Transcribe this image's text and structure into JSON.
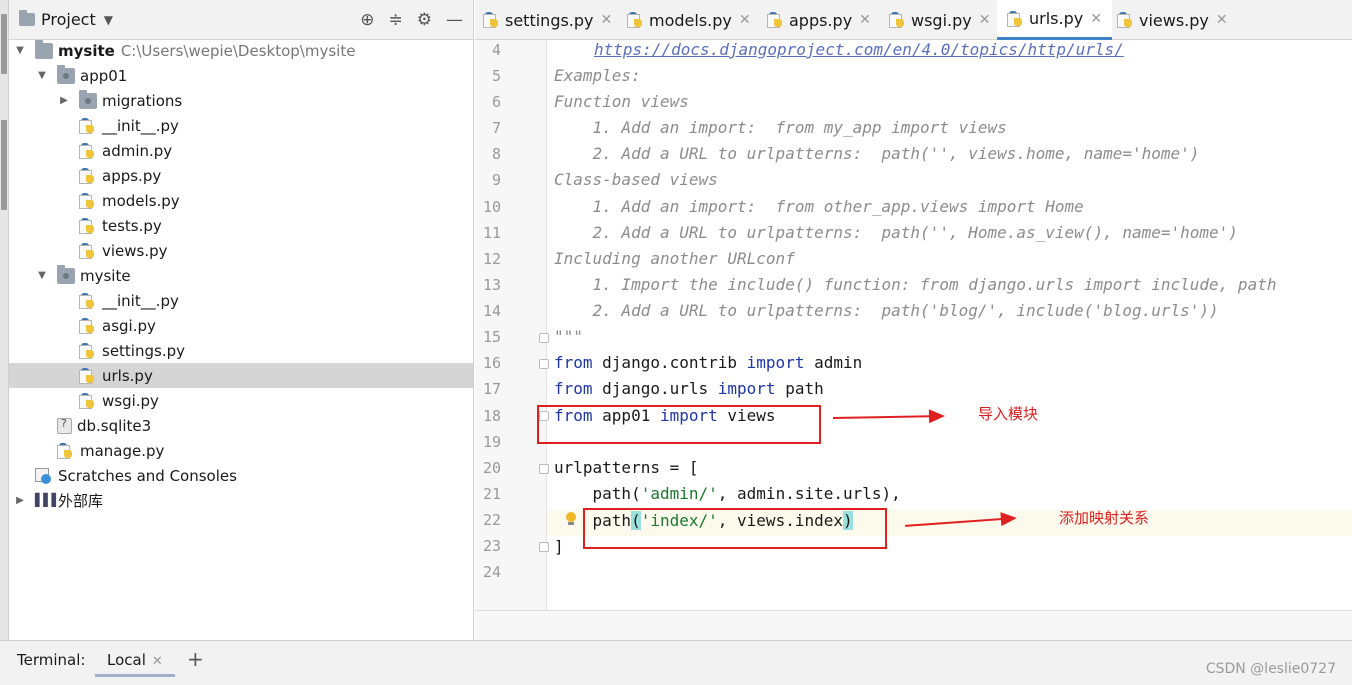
{
  "project_panel": {
    "title": "Project",
    "tree": [
      {
        "label": "mysite",
        "path": "C:\\Users\\wepie\\Desktop\\mysite",
        "kind": "folder",
        "expanded": true
      },
      {
        "label": "app01",
        "kind": "package",
        "expanded": true
      },
      {
        "label": "migrations",
        "kind": "package",
        "expanded": false
      },
      {
        "label": "__init__.py",
        "kind": "python"
      },
      {
        "label": "admin.py",
        "kind": "python"
      },
      {
        "label": "apps.py",
        "kind": "python"
      },
      {
        "label": "models.py",
        "kind": "python"
      },
      {
        "label": "tests.py",
        "kind": "python"
      },
      {
        "label": "views.py",
        "kind": "python"
      },
      {
        "label": "mysite",
        "kind": "package",
        "expanded": true
      },
      {
        "label": "__init__.py",
        "kind": "python"
      },
      {
        "label": "asgi.py",
        "kind": "python"
      },
      {
        "label": "settings.py",
        "kind": "python"
      },
      {
        "label": "urls.py",
        "kind": "python",
        "selected": true
      },
      {
        "label": "wsgi.py",
        "kind": "python"
      },
      {
        "label": "db.sqlite3",
        "kind": "database"
      },
      {
        "label": "manage.py",
        "kind": "python"
      },
      {
        "label": "Scratches and Consoles",
        "kind": "scratches"
      },
      {
        "label": "外部库",
        "kind": "library",
        "expanded": false
      }
    ]
  },
  "editor": {
    "tabs": [
      {
        "label": "settings.py",
        "active": false
      },
      {
        "label": "models.py",
        "active": false
      },
      {
        "label": "apps.py",
        "active": false
      },
      {
        "label": "wsgi.py",
        "active": false
      },
      {
        "label": "urls.py",
        "active": true
      },
      {
        "label": "views.py",
        "active": false
      }
    ],
    "line_numbers": [
      "4",
      "5",
      "6",
      "7",
      "8",
      "9",
      "10",
      "11",
      "12",
      "13",
      "14",
      "15",
      "16",
      "17",
      "18",
      "19",
      "20",
      "21",
      "22",
      "23",
      "24"
    ],
    "code": {
      "l4": "https://docs.djangoproject.com/en/4.0/topics/http/urls/",
      "l5": "Examples:",
      "l6": "Function views",
      "l7": "    1. Add an import:  from my_app import views",
      "l8": "    2. Add a URL to urlpatterns:  path('', views.home, name='home')",
      "l9": "Class-based views",
      "l10": "    1. Add an import:  from other_app.views import Home",
      "l11": "    2. Add a URL to urlpatterns:  path('', Home.as_view(), name='home')",
      "l12": "Including another URLconf",
      "l13": "    1. Import the include() function: from django.urls import include, path",
      "l14": "    2. Add a URL to urlpatterns:  path('blog/', include('blog.urls'))",
      "l15": "\"\"\"",
      "l16": {
        "from": "from",
        "module": " django.contrib ",
        "import": "import",
        "name": " admin"
      },
      "l17": {
        "from": "from",
        "module": " django.urls ",
        "import": "import",
        "name": " path"
      },
      "l18": {
        "from": "from",
        "module": " app01 ",
        "import": "import",
        "name": " views"
      },
      "l20": "urlpatterns = [",
      "l21": {
        "pre": "    path(",
        "arg": "'admin/'",
        "post": ", admin.site.urls),"
      },
      "l22": {
        "pre": "    path",
        "open": "(",
        "arg": "'index/'",
        "mid": ", views.index",
        "close": ")"
      },
      "l23": "]"
    }
  },
  "annotations": {
    "import_note": "导入模块",
    "mapping_note": "添加映射关系",
    "color": "#e02020"
  },
  "terminal": {
    "label": "Terminal:",
    "tab": "Local",
    "add": "+"
  },
  "watermark": "CSDN @leslie0727"
}
